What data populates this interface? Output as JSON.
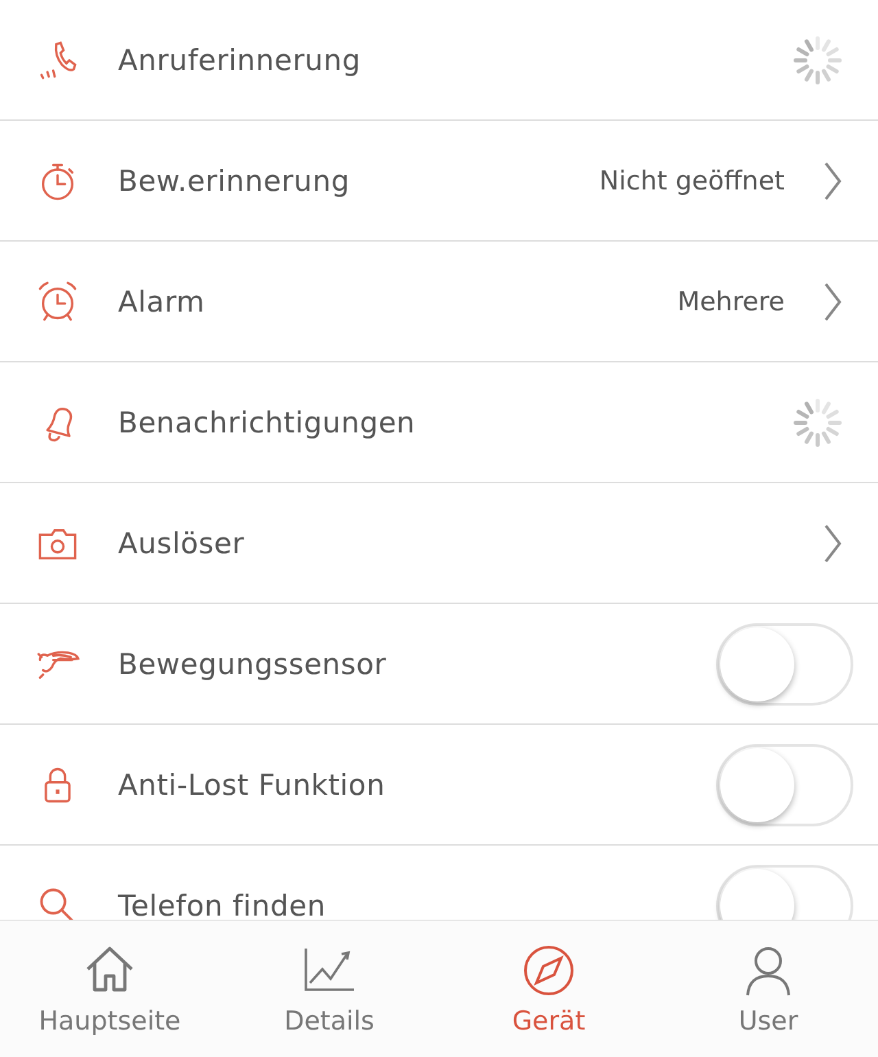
{
  "settings": [
    {
      "label": "Anruferinnerung",
      "kind": "loading"
    },
    {
      "label": "Bew.erinnerung",
      "kind": "link",
      "value": "Nicht geöffnet"
    },
    {
      "label": "Alarm",
      "kind": "link",
      "value": "Mehrere"
    },
    {
      "label": "Benachrichtigungen",
      "kind": "loading"
    },
    {
      "label": "Auslöser",
      "kind": "link"
    },
    {
      "label": "Bewegungssensor",
      "kind": "toggle",
      "on": false
    },
    {
      "label": "Anti-Lost Funktion",
      "kind": "toggle",
      "on": false
    },
    {
      "label": "Telefon finden",
      "kind": "toggle",
      "on": false
    }
  ],
  "tab_bar": [
    {
      "label": "Hauptseite",
      "selected": false
    },
    {
      "label": "Details",
      "selected": false
    },
    {
      "label": "Gerät",
      "selected": true
    },
    {
      "label": "User",
      "selected": false
    }
  ]
}
